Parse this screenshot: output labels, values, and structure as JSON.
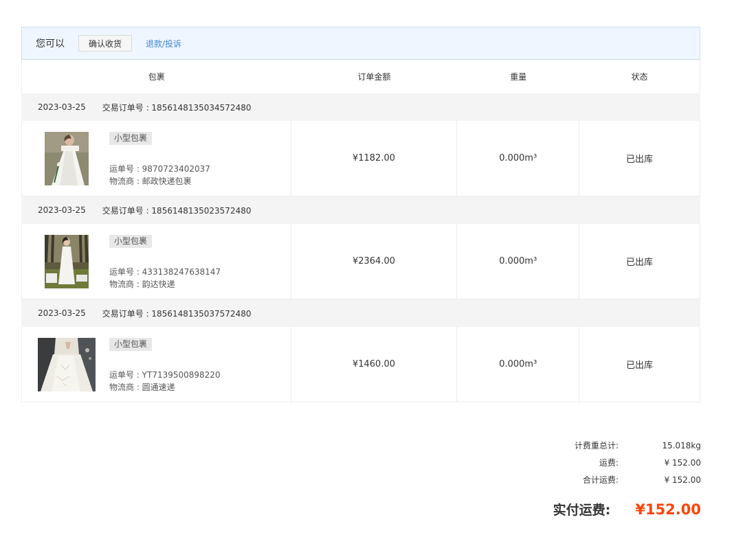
{
  "actions": {
    "lead": "您可以",
    "confirm_button": "确认收货",
    "refund_link": "退款/投诉"
  },
  "columns": [
    "包裹",
    "订单金额",
    "重量",
    "状态"
  ],
  "groups": [
    {
      "date": "2023-03-25",
      "order_no": "交易订单号 : 1856148135034572480",
      "tag": "小型包裹",
      "tracking": "运单号 : 9870723402037",
      "carrier": "物流商 : 邮政快递包裹",
      "amount": "¥1182.00",
      "weight": "0.000m³",
      "status": "已出库"
    },
    {
      "date": "2023-03-25",
      "order_no": "交易订单号 : 1856148135023572480",
      "tag": "小型包裹",
      "tracking": "运单号 : 433138247638147",
      "carrier": "物流商 : 韵达快递",
      "amount": "¥2364.00",
      "weight": "0.000m³",
      "status": "已出库"
    },
    {
      "date": "2023-03-25",
      "order_no": "交易订单号 : 1856148135037572480",
      "tag": "小型包裹",
      "tracking": "运单号 : YT7139500898220",
      "carrier": "物流商 : 圆通速递",
      "amount": "¥1460.00",
      "weight": "0.000m³",
      "status": "已出库"
    }
  ],
  "summary": {
    "billed_weight_label": "计费重总计:",
    "billed_weight_value": "15.018kg",
    "shipping_label": "运费:",
    "shipping_value": "¥ 152.00",
    "total_shipping_label": "合计运费:",
    "total_shipping_value": "¥ 152.00",
    "paid_label": "实付运费:",
    "paid_value": "¥152.00"
  },
  "colors": {
    "accent_link": "#3a86d6",
    "price_highlight": "#ff4400",
    "action_bar_bg": "#f0f6ff"
  }
}
